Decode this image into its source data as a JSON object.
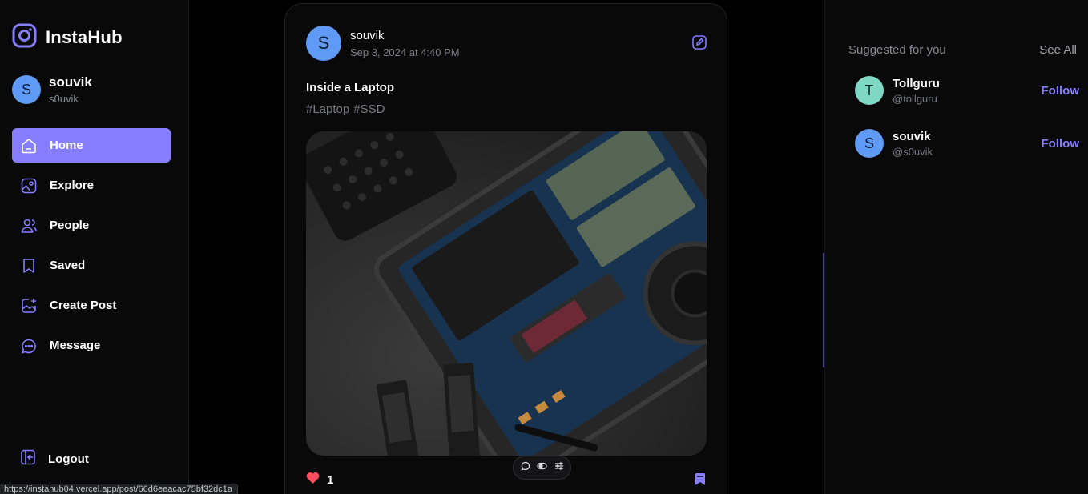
{
  "brand": {
    "name": "InstaHub",
    "accent": "#877eff"
  },
  "profile": {
    "initial": "S",
    "name": "souvik",
    "handle": "s0uvik"
  },
  "nav": [
    {
      "label": "Home",
      "icon": "home-icon",
      "active": true
    },
    {
      "label": "Explore",
      "icon": "explore-icon"
    },
    {
      "label": "People",
      "icon": "people-icon"
    },
    {
      "label": "Saved",
      "icon": "saved-icon"
    },
    {
      "label": "Create Post",
      "icon": "create-post-icon"
    },
    {
      "label": "Message",
      "icon": "message-icon"
    }
  ],
  "logout": {
    "label": "Logout"
  },
  "status_url": "https://instahub04.vercel.app/post/66d6eeacac75bf32dc1a",
  "post": {
    "author": {
      "initial": "S",
      "name": "souvik"
    },
    "date": "Sep 3, 2024 at 4:40 PM",
    "caption": "Inside a Laptop",
    "tags": [
      "#Laptop",
      "#SSD"
    ],
    "likes": "1",
    "image": "laptop-internals-photo"
  },
  "suggested": {
    "title": "Suggested for you",
    "see_all": "See All",
    "users": [
      {
        "initial": "T",
        "name": "Tollguru",
        "handle": "@tollguru",
        "color": "#7fd8c4",
        "action": "Follow"
      },
      {
        "initial": "S",
        "name": "souvik",
        "handle": "@s0uvik",
        "color": "#5f9bf6",
        "action": "Follow"
      }
    ]
  }
}
